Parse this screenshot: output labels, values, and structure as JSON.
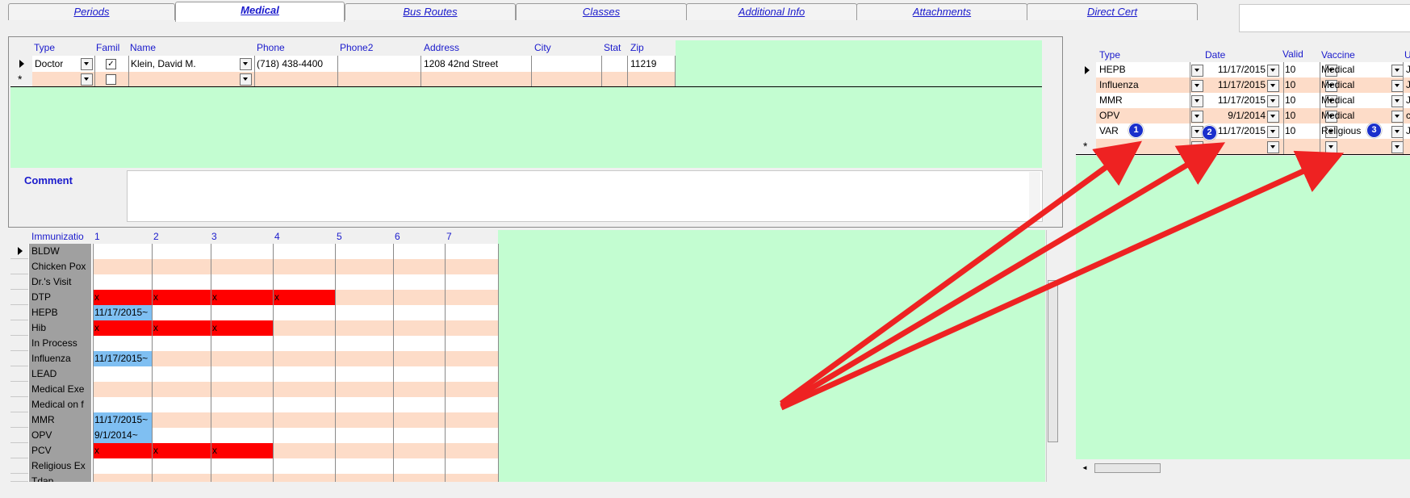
{
  "tabs": [
    {
      "label": "Periods",
      "active": false
    },
    {
      "label": "Medical",
      "active": true
    },
    {
      "label": "Bus Routes",
      "active": false
    },
    {
      "label": "Classes",
      "active": false
    },
    {
      "label": "Additional Info",
      "active": false
    },
    {
      "label": "Attachments",
      "active": false
    },
    {
      "label": "Direct Cert",
      "active": false
    }
  ],
  "doctors": {
    "headers": {
      "type": "Type",
      "family": "Famil",
      "name": "Name",
      "phone": "Phone",
      "phone2": "Phone2",
      "address": "Address",
      "city": "City",
      "stat": "Stat",
      "zip": "Zip"
    },
    "rows": [
      {
        "type": "Doctor",
        "family_checked": true,
        "name": "Klein, David M.",
        "phone": "(718) 438-4400",
        "phone2": "",
        "address": "1208 42nd Street",
        "city": "",
        "stat": "",
        "zip": "11219"
      }
    ],
    "new_row_marker": "*"
  },
  "comment": {
    "label": "Comment",
    "value": ""
  },
  "immunization_grid": {
    "headers": [
      "Immunizatio",
      "1",
      "2",
      "3",
      "4",
      "5",
      "6",
      "7"
    ],
    "rows": [
      {
        "label": "BLDW",
        "cells": [
          "",
          "",
          "",
          "",
          "",
          "",
          ""
        ]
      },
      {
        "label": "Chicken Pox",
        "cells": [
          "",
          "",
          "",
          "",
          "",
          "",
          ""
        ]
      },
      {
        "label": "Dr.'s Visit",
        "cells": [
          "",
          "",
          "",
          "",
          "",
          "",
          ""
        ]
      },
      {
        "label": "DTP",
        "cells": [
          "x",
          "x",
          "x",
          "x",
          "",
          "",
          ""
        ]
      },
      {
        "label": "HEPB",
        "cells": [
          "11/17/2015~",
          "",
          "",
          "",
          "",
          "",
          ""
        ]
      },
      {
        "label": "Hib",
        "cells": [
          "x",
          "x",
          "x",
          "",
          "",
          "",
          ""
        ]
      },
      {
        "label": "In Process",
        "cells": [
          "",
          "",
          "",
          "",
          "",
          "",
          ""
        ]
      },
      {
        "label": "Influenza",
        "cells": [
          "11/17/2015~",
          "",
          "",
          "",
          "",
          "",
          ""
        ]
      },
      {
        "label": "LEAD",
        "cells": [
          "",
          "",
          "",
          "",
          "",
          "",
          ""
        ]
      },
      {
        "label": "Medical Exe",
        "cells": [
          "",
          "",
          "",
          "",
          "",
          "",
          ""
        ]
      },
      {
        "label": "Medical on f",
        "cells": [
          "",
          "",
          "",
          "",
          "",
          "",
          ""
        ]
      },
      {
        "label": "MMR",
        "cells": [
          "11/17/2015~",
          "",
          "",
          "",
          "",
          "",
          ""
        ]
      },
      {
        "label": "OPV",
        "cells": [
          "9/1/2014~",
          "",
          "",
          "",
          "",
          "",
          ""
        ]
      },
      {
        "label": "PCV",
        "cells": [
          "x",
          "x",
          "x",
          "",
          "",
          "",
          ""
        ]
      },
      {
        "label": "Religious Ex",
        "cells": [
          "",
          "",
          "",
          "",
          "",
          "",
          ""
        ]
      },
      {
        "label": "Tdap",
        "cells": [
          "",
          "",
          "",
          "",
          "",
          "",
          ""
        ]
      }
    ]
  },
  "exemptions": {
    "headers": {
      "type": "Type",
      "date": "Date",
      "valid": "Valid",
      "vaccine": "Vaccine",
      "u": "U"
    },
    "rows": [
      {
        "type": "HEPB",
        "date": "11/17/2015",
        "valid": "10",
        "vaccine": "Medical",
        "u": "J"
      },
      {
        "type": "Influenza",
        "date": "11/17/2015",
        "valid": "10",
        "vaccine": "Medical",
        "u": "J"
      },
      {
        "type": "MMR",
        "date": "11/17/2015",
        "valid": "10",
        "vaccine": "Medical",
        "u": "J"
      },
      {
        "type": "OPV",
        "date": "9/1/2014",
        "valid": "10",
        "vaccine": "Medical",
        "u": "c"
      },
      {
        "type": "VAR",
        "date": "11/17/2015",
        "valid": "10",
        "vaccine": "Religious",
        "u": "J"
      }
    ],
    "new_row_marker": "*"
  },
  "annotations": [
    {
      "number": "1"
    },
    {
      "number": "2"
    },
    {
      "number": "3"
    }
  ],
  "colors": {
    "grid_green": "#c3fdd1",
    "row_peach": "#fddcc8",
    "mark_red": "#ff0000",
    "date_blue": "#7fbff2",
    "arrow_red": "#ee2222",
    "link_blue": "#1a1acc"
  }
}
